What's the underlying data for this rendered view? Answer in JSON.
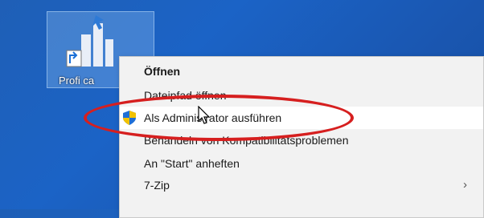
{
  "desktop": {
    "icon": {
      "label": "Profi ca",
      "name": "profi-cash-shortcut"
    }
  },
  "context_menu": {
    "items": [
      {
        "label": "Öffnen",
        "bold": true
      },
      {
        "label": "Dateipfad öffnen"
      },
      {
        "label": "Als Administrator ausführen",
        "icon": "uac-shield-icon"
      },
      {
        "label": "Behandeln von Kompatibilitätsproblemen"
      },
      {
        "label": "An \"Start\" anheften"
      },
      {
        "label": "7-Zip",
        "submenu": true,
        "chevron": "›"
      }
    ]
  },
  "colors": {
    "highlight": "#d61f1f",
    "desktop_bg": "#1b63c6",
    "menu_bg": "#f2f2f2"
  }
}
